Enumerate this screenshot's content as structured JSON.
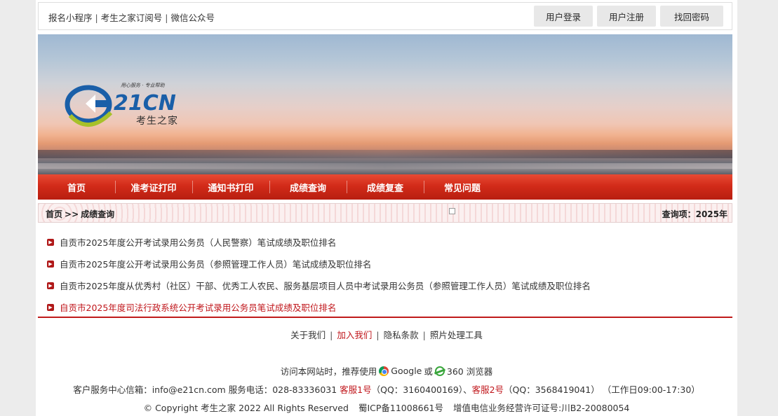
{
  "topbar": {
    "links": [
      "报名小程序",
      "考生之家订阅号",
      "微信公众号"
    ],
    "separator": "|",
    "buttons": [
      "用户登录",
      "用户注册",
      "找回密码"
    ]
  },
  "banner": {
    "logo_text": "21CN",
    "logo_sub": "考生之家",
    "logo_slogan": "用心服务 · 专业帮助"
  },
  "nav": [
    "首页",
    "准考证打印",
    "通知书打印",
    "成绩查询",
    "成绩复查",
    "常见问题"
  ],
  "breadcrumb": {
    "home": "首页",
    "arrow": ">>",
    "current": "成绩查询",
    "query_label": "查询项：2025年"
  },
  "list": [
    "自贡市2025年度公开考试录用公务员（人民警察）笔试成绩及职位排名",
    "自贡市2025年度公开考试录用公务员（参照管理工作人员）笔试成绩及职位排名",
    "自贡市2025年度从优秀村（社区）干部、优秀工人农民、服务基层项目人员中考试录用公务员（参照管理工作人员）笔试成绩及职位排名",
    "自贡市2025年度司法行政系统公开考试录用公务员笔试成绩及职位排名"
  ],
  "footer": {
    "links": [
      "关于我们",
      "加入我们",
      "隐私条款",
      "照片处理工具"
    ],
    "browser_prefix": "访问本网站时，推荐使用",
    "browser_google": "Google",
    "browser_or": "或",
    "browser_360": "360 浏览器",
    "contact_email": "客户服务中心信箱：info@e21cn.com",
    "contact_phone": "服务电话：028-83336031",
    "kefu1": "客服1号",
    "kefu1_qq": "（QQ：3160400169）、",
    "kefu2": "客服2号",
    "kefu2_qq": "（QQ：3568419041）",
    "work_hours": "（工作日09:00-17:30）",
    "copyright": "© Copyright 考生之家 2022 All Rights Reserved",
    "icp": "蜀ICP备11008661号",
    "license": "增值电信业务经营许可证号:川B2-20080054"
  },
  "colors": {
    "nav_red": "#d22b19",
    "link_red": "#c0161b",
    "logo_blue": "#1a5fa8",
    "logo_green": "#a7c12a"
  }
}
